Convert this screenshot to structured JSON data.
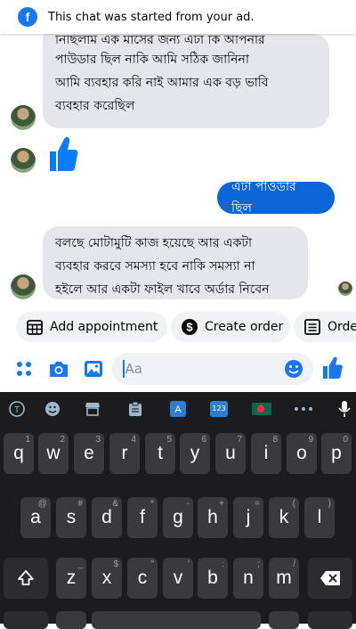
{
  "banner": {
    "text": "This chat was started from your ad."
  },
  "messages": {
    "incoming_1": [
      "নিছিলাম এক মাসের জন্য এটা কি আপনার",
      "পাউডার ছিল নাকি আমি সঠিক জানিনা",
      "আমি ব্যবহার করি নাই আমার এক বড় ভাবি",
      "ব্যবহার করেছিল"
    ],
    "outgoing_1": "এটা পাওডার ছিল",
    "incoming_2": [
      "বলছে মোটামুটি কাজ হয়েছে আর একটা",
      "ব্যবহার করবে সমস্যা হবে নাকি সমস্যা না",
      "হইলে আর একটা ফাইল খাবে অর্ডার নিবেন"
    ]
  },
  "quick_actions": {
    "add_appointment": "Add appointment",
    "create_order": "Create order",
    "orders": "Orde"
  },
  "composer": {
    "placeholder": "Aa"
  },
  "keyboard": {
    "row1": [
      [
        "q",
        "1"
      ],
      [
        "w",
        "2"
      ],
      [
        "e",
        "3"
      ],
      [
        "r",
        "4"
      ],
      [
        "t",
        "5"
      ],
      [
        "y",
        "6"
      ],
      [
        "u",
        "7"
      ],
      [
        "i",
        "8"
      ],
      [
        "o",
        "9"
      ],
      [
        "p",
        "0"
      ]
    ],
    "row2": [
      [
        "a",
        "@"
      ],
      [
        "s",
        "#"
      ],
      [
        "d",
        "&"
      ],
      [
        "f",
        "*"
      ],
      [
        "g",
        "-"
      ],
      [
        "h",
        "+"
      ],
      [
        "j",
        "="
      ],
      [
        "k",
        "("
      ],
      [
        "l",
        ")"
      ]
    ],
    "row3": [
      [
        "z",
        "_"
      ],
      [
        "x",
        "$"
      ],
      [
        "c",
        "\""
      ],
      [
        "v",
        "'"
      ],
      [
        "b",
        ":"
      ],
      [
        "n",
        ";"
      ],
      [
        "m",
        "/"
      ]
    ],
    "toolbar_badge": "123"
  },
  "colors": {
    "accent": "#1877f2",
    "outgoing_bubble": "#0a66d8",
    "incoming_bubble": "#e4e6eb",
    "keyboard_bg": "#1c1c1e"
  }
}
